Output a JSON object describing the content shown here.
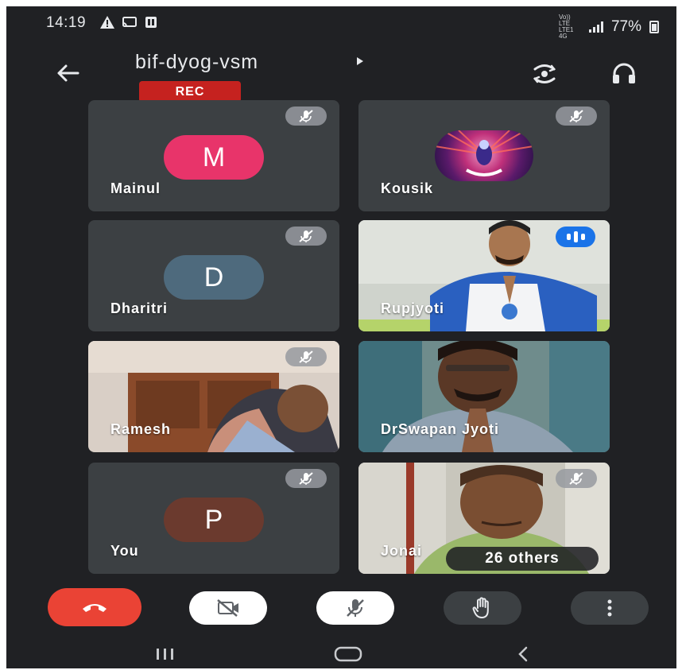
{
  "status_bar": {
    "time": "14:19",
    "network_label_top": "Vo)) LTE",
    "network_label_bottom": "LTE1 4G",
    "battery_percent": "77%",
    "left_icon_names": [
      "warning-icon",
      "cast-icon",
      "notification-icon"
    ]
  },
  "header": {
    "meeting_code": "bif-dyog-vsm",
    "rec_label": "REC",
    "icons": {
      "back": "arrow-left-icon",
      "switch_camera": "camera-switch-icon",
      "audio": "headphones-icon"
    }
  },
  "participants": [
    {
      "name": "Mainul",
      "initial": "M",
      "avatar_color": "#e8346a",
      "muted": true,
      "video": false
    },
    {
      "name": "Kousik",
      "initial": "",
      "avatar_color": "#5a1a6a",
      "muted": true,
      "video": false
    },
    {
      "name": "Dharitri",
      "initial": "D",
      "avatar_color": "#4e6a7d",
      "muted": true,
      "video": false
    },
    {
      "name": "Rupjyoti",
      "initial": "",
      "muted": false,
      "speaking": true,
      "video": true
    },
    {
      "name": "Ramesh",
      "initial": "",
      "muted": true,
      "video": true
    },
    {
      "name": "DrSwapan Jyoti",
      "initial": "",
      "muted": false,
      "video": true
    },
    {
      "name": "You",
      "initial": "P",
      "avatar_color": "#6b3a2e",
      "muted": true,
      "video": false
    },
    {
      "name": "Jonai",
      "initial": "",
      "muted": true,
      "video": true
    }
  ],
  "others_chip": "26 others",
  "controls": {
    "end_call": "end-call-icon",
    "camera": "camera-off-icon",
    "mic": "mic-off-icon",
    "raise_hand": "raise-hand-icon",
    "more": "more-vert-icon"
  },
  "colors": {
    "background": "#202124",
    "tile": "#3c4043",
    "end_call": "#ea4335",
    "rec": "#c5221f",
    "speaking": "#1a73e8"
  }
}
